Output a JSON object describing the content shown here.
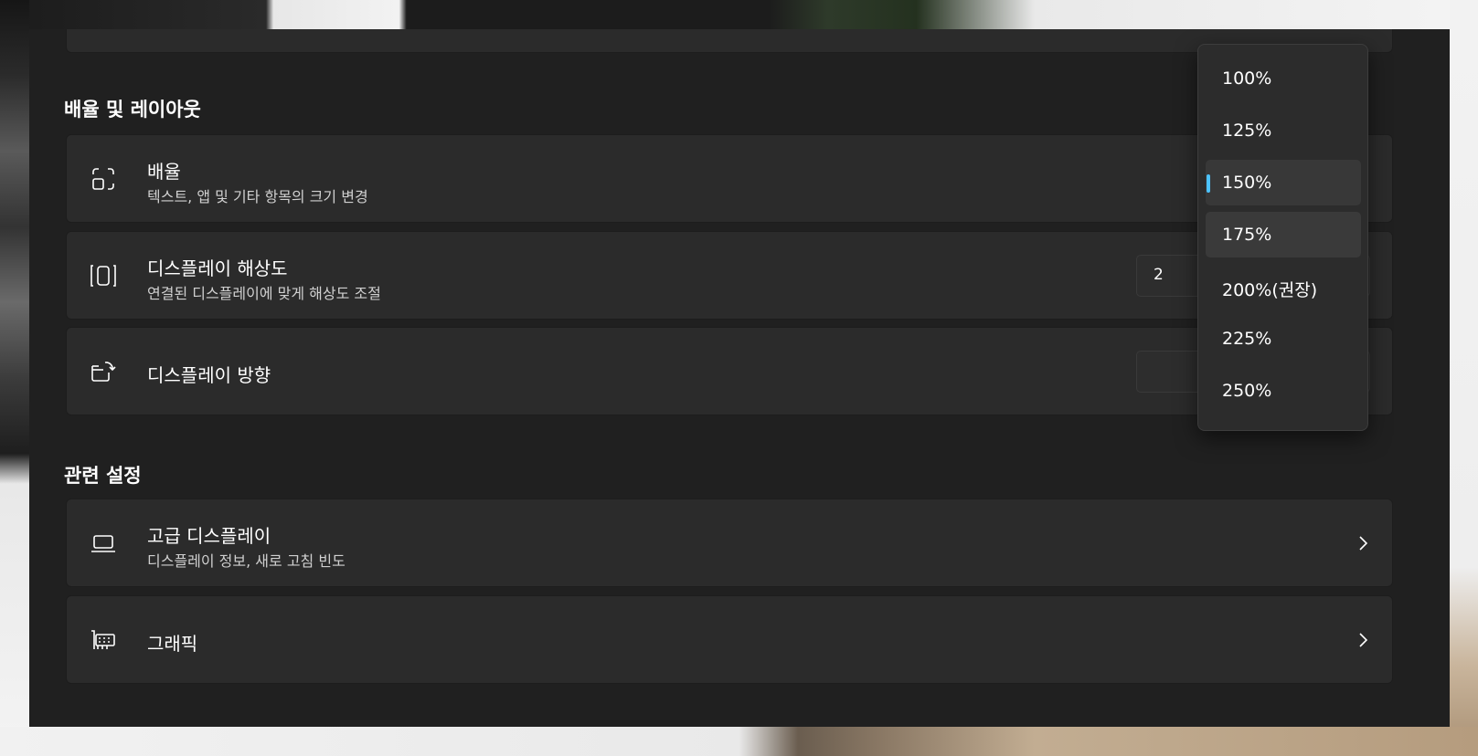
{
  "sections": {
    "scale_layout": "배율 및 레이아웃",
    "related": "관련 설정"
  },
  "cards": {
    "scale": {
      "title": "배율",
      "sub": "텍스트, 앱 및 기타 항목의 크기 변경"
    },
    "resolution": {
      "title": "디스플레이 해상도",
      "sub": " 연결된 디스플레이에 맞게 해상도 조절",
      "value": "2"
    },
    "orientation": {
      "title": "디스플레이 방향"
    },
    "advanced": {
      "title": "고급 디스플레이",
      "sub": "디스플레이 정보, 새로 고침 빈도"
    },
    "graphics": {
      "title": "그래픽"
    }
  },
  "scale_options": {
    "items": [
      "100%",
      "125%",
      "150%",
      "175%",
      "200%(권장)",
      "225%",
      "250%"
    ],
    "selected": "150%",
    "hovered": "175%"
  },
  "colors": {
    "accent": "#4cc2ff",
    "window": "#202020",
    "card": "#2b2b2b"
  },
  "icons": {
    "scale": "scale-icon",
    "resolution": "resolution-icon",
    "orientation": "rotate-display-icon",
    "advanced": "laptop-icon",
    "graphics": "graphics-card-icon",
    "chevron": "chevron-right-icon",
    "dropdown": "chevron-down-icon"
  }
}
